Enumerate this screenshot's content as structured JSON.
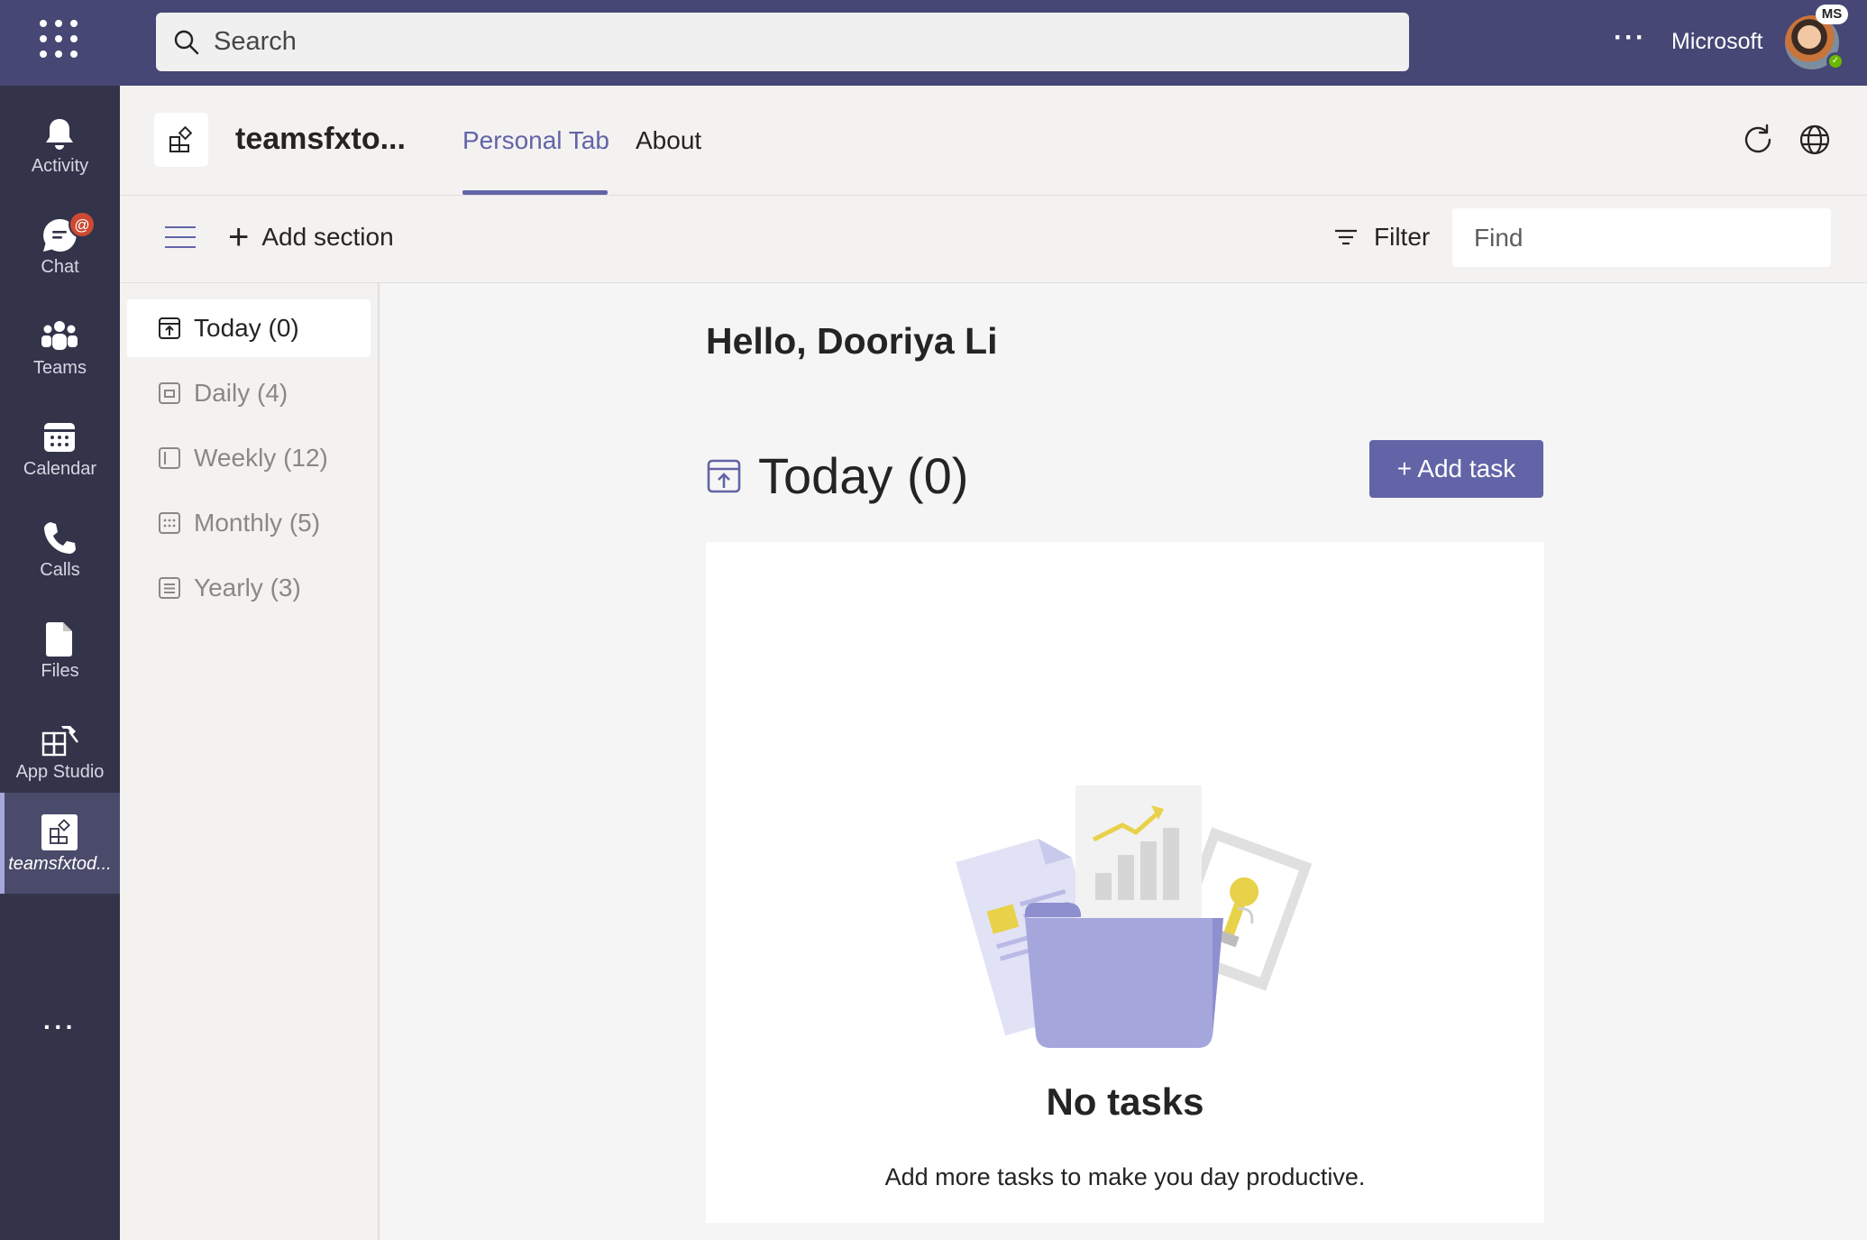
{
  "topbar": {
    "search_placeholder": "Search",
    "more_label": "···",
    "tenant": "Microsoft",
    "avatar_badge": "MS",
    "presence": "available"
  },
  "rail": {
    "items": [
      {
        "label": "Activity",
        "icon": "bell-icon"
      },
      {
        "label": "Chat",
        "icon": "chat-icon"
      },
      {
        "label": "Teams",
        "icon": "teams-icon"
      },
      {
        "label": "Calendar",
        "icon": "calendar-icon"
      },
      {
        "label": "Calls",
        "icon": "phone-icon"
      },
      {
        "label": "Files",
        "icon": "file-icon"
      },
      {
        "label": "App Studio",
        "icon": "app-studio-icon"
      },
      {
        "label": "teamsfxtod...",
        "icon": "app-icon",
        "active": true
      }
    ],
    "mention_badge": "@",
    "more_label": "···"
  },
  "app": {
    "title": "teamsfxto...",
    "tabs": [
      {
        "label": "Personal Tab",
        "selected": true
      },
      {
        "label": "About",
        "selected": false
      }
    ]
  },
  "toolbar": {
    "add_section_label": "Add section",
    "filter_label": "Filter",
    "find_placeholder": "Find"
  },
  "sections": [
    {
      "label": "Today (0)",
      "icon": "today-icon",
      "selected": true
    },
    {
      "label": "Daily (4)",
      "icon": "daily-icon"
    },
    {
      "label": "Weekly (12)",
      "icon": "weekly-icon"
    },
    {
      "label": "Monthly (5)",
      "icon": "monthly-icon"
    },
    {
      "label": "Yearly (3)",
      "icon": "yearly-icon"
    }
  ],
  "main": {
    "greeting": "Hello, Dooriya Li",
    "section_title": "Today (0)",
    "add_task_label": "+ Add task",
    "empty_title": "No tasks",
    "empty_subtitle": "Add more tasks to make you day productive."
  },
  "colors": {
    "brand": "#6264a7",
    "topbar": "#464775",
    "rail": "#33344a",
    "mention": "#cc4a31"
  }
}
